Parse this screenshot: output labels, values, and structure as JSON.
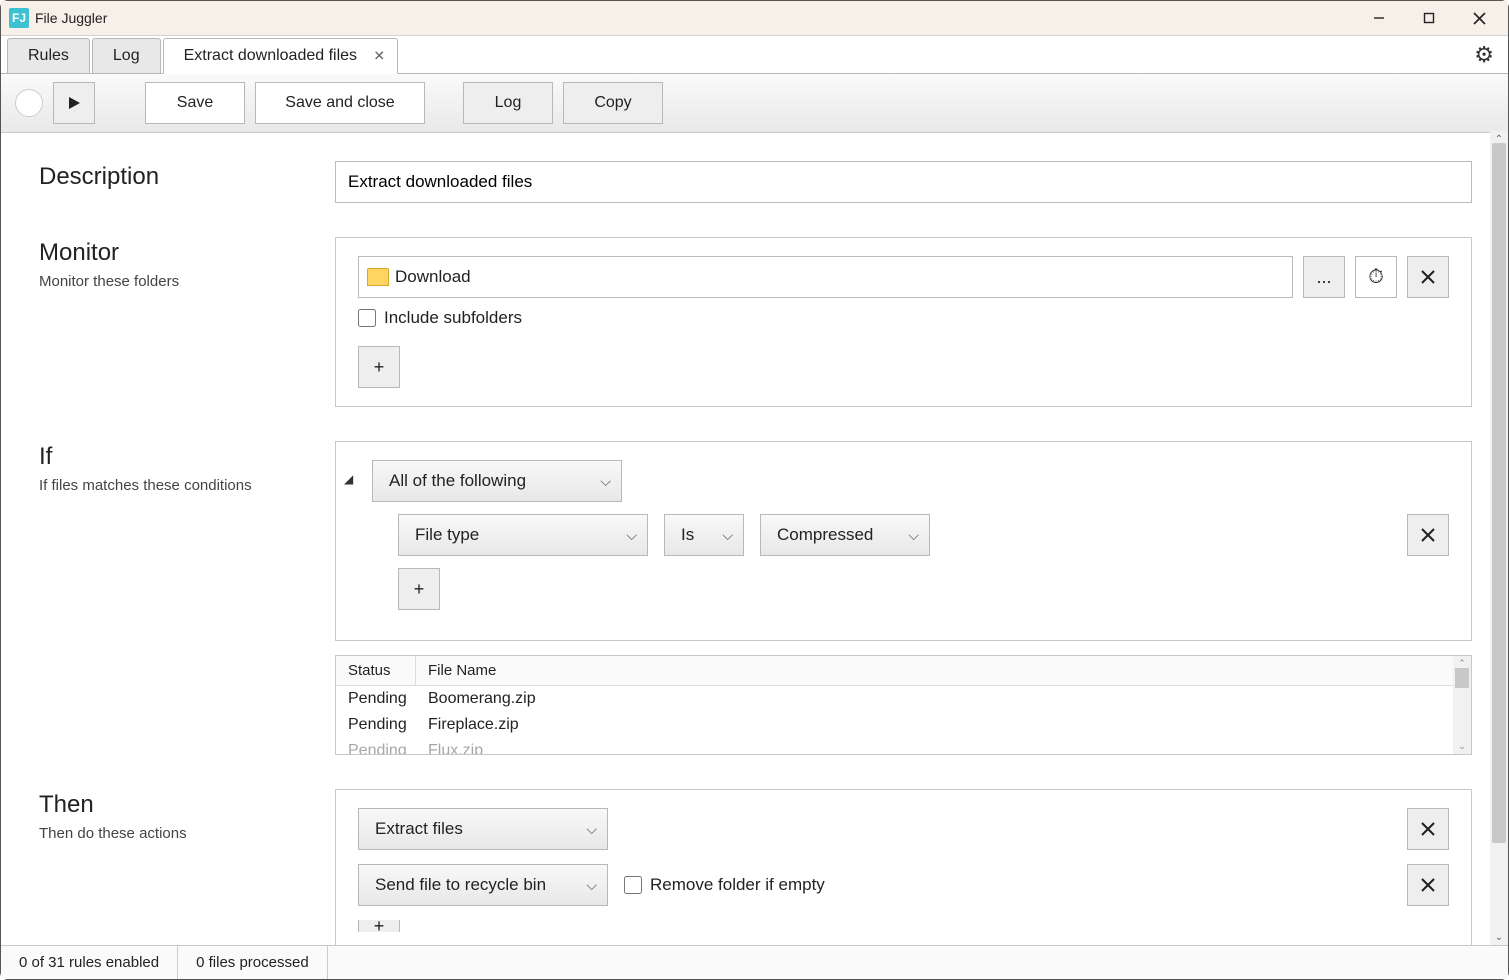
{
  "app": {
    "title": "File Juggler"
  },
  "tabs": {
    "rules": "Rules",
    "log": "Log",
    "active": "Extract downloaded files"
  },
  "toolbar": {
    "save": "Save",
    "save_close": "Save and close",
    "log": "Log",
    "copy": "Copy"
  },
  "description": {
    "heading": "Description",
    "value": "Extract downloaded files"
  },
  "monitor": {
    "heading": "Monitor",
    "sub": "Monitor these folders",
    "folder": "Download",
    "browse": "...",
    "include_sub": "Include subfolders",
    "add": "+"
  },
  "ifsec": {
    "heading": "If",
    "sub": "If files matches these conditions",
    "group": "All of the following",
    "field": "File type",
    "op": "Is",
    "value": "Compressed",
    "add": "+",
    "table": {
      "status_h": "Status",
      "name_h": "File Name",
      "rows": [
        {
          "status": "Pending",
          "name": "Boomerang.zip"
        },
        {
          "status": "Pending",
          "name": "Fireplace.zip"
        },
        {
          "status": "Pending",
          "name": "Flux.zip"
        }
      ]
    }
  },
  "then": {
    "heading": "Then",
    "sub": "Then do these actions",
    "action1": "Extract files",
    "action2": "Send file to recycle bin",
    "remove_empty": "Remove folder if empty"
  },
  "status": {
    "rules": "0 of 31 rules enabled",
    "files": "0 files processed"
  }
}
